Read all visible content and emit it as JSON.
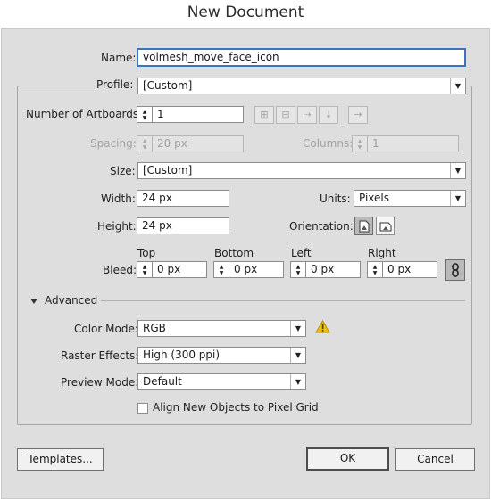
{
  "window": {
    "title": "New Document"
  },
  "name": {
    "label": "Name:",
    "value": "volmesh_move_face_icon"
  },
  "profile": {
    "label": "Profile:",
    "value": "[Custom]"
  },
  "artboards": {
    "count_label": "Number of Artboards:",
    "count_value": "1",
    "spacing_label": "Spacing:",
    "spacing_value": "20 px",
    "columns_label": "Columns:",
    "columns_value": "1"
  },
  "size": {
    "label": "Size:",
    "value": "[Custom]"
  },
  "width": {
    "label": "Width:",
    "value": "24 px"
  },
  "height": {
    "label": "Height:",
    "value": "24 px"
  },
  "units": {
    "label": "Units:",
    "value": "Pixels"
  },
  "orientation": {
    "label": "Orientation:",
    "selected": "portrait"
  },
  "bleed": {
    "label": "Bleed:",
    "top_label": "Top",
    "top_value": "0 px",
    "bottom_label": "Bottom",
    "bottom_value": "0 px",
    "left_label": "Left",
    "left_value": "0 px",
    "right_label": "Right",
    "right_value": "0 px"
  },
  "advanced": {
    "toggle_label": "Advanced",
    "color_mode_label": "Color Mode:",
    "color_mode_value": "RGB",
    "raster_label": "Raster Effects:",
    "raster_value": "High (300 ppi)",
    "preview_label": "Preview Mode:",
    "preview_value": "Default",
    "align_pixel_grid_label": "Align New Objects to Pixel Grid",
    "align_pixel_grid_checked": false
  },
  "buttons": {
    "templates": "Templates...",
    "ok": "OK",
    "cancel": "Cancel"
  },
  "colors": {
    "focus_border": "#3e73b8",
    "warning": "#f2c200",
    "dialog_bg": "#dedede"
  }
}
